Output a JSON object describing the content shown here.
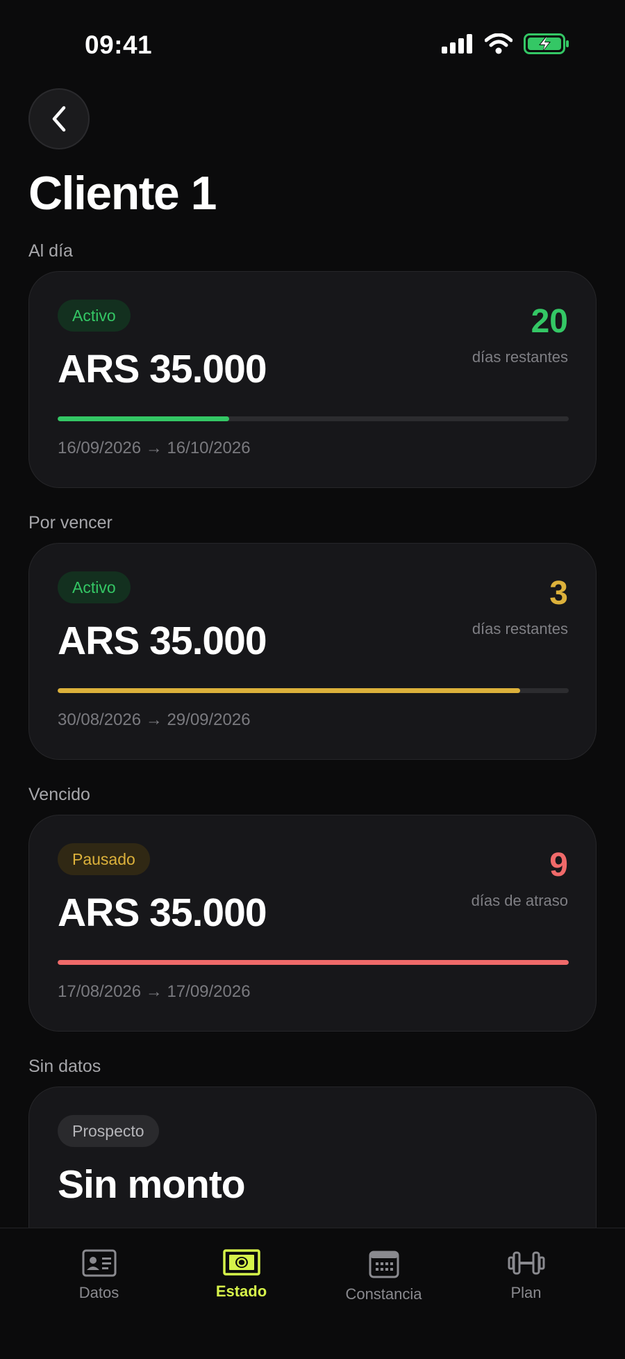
{
  "status_bar": {
    "time": "09:41"
  },
  "page": {
    "title": "Cliente 1"
  },
  "cards": [
    {
      "section": "Al día",
      "badge": "Activo",
      "amount": "ARS 35.000",
      "days": "20",
      "days_label": "días restantes",
      "progress": 0.335,
      "dates": "16/09/2026 → 16/10/2026"
    },
    {
      "section": "Por vencer",
      "badge": "Activo",
      "amount": "ARS 35.000",
      "days": "3",
      "days_label": "días restantes",
      "progress": 0.905,
      "dates": "30/08/2026 → 29/09/2026"
    },
    {
      "section": "Vencido",
      "badge": "Pausado",
      "amount": "ARS 35.000",
      "days": "9",
      "days_label": "días de atraso",
      "progress": 1.0,
      "dates": "17/08/2026 → 17/09/2026"
    },
    {
      "section": "Sin datos",
      "badge": "Prospecto",
      "amount": "Sin monto"
    }
  ],
  "tabs": [
    {
      "label": "Datos",
      "icon": "id-card-icon"
    },
    {
      "label": "Estado",
      "icon": "banknote-icon",
      "active": true
    },
    {
      "label": "Constancia",
      "icon": "calendar-icon"
    },
    {
      "label": "Plan",
      "icon": "dumbbell-icon"
    }
  ],
  "colors": {
    "accent": "#d6f34a",
    "green": "#34c765",
    "yellow": "#dcb13b",
    "red": "#f06a6a"
  }
}
